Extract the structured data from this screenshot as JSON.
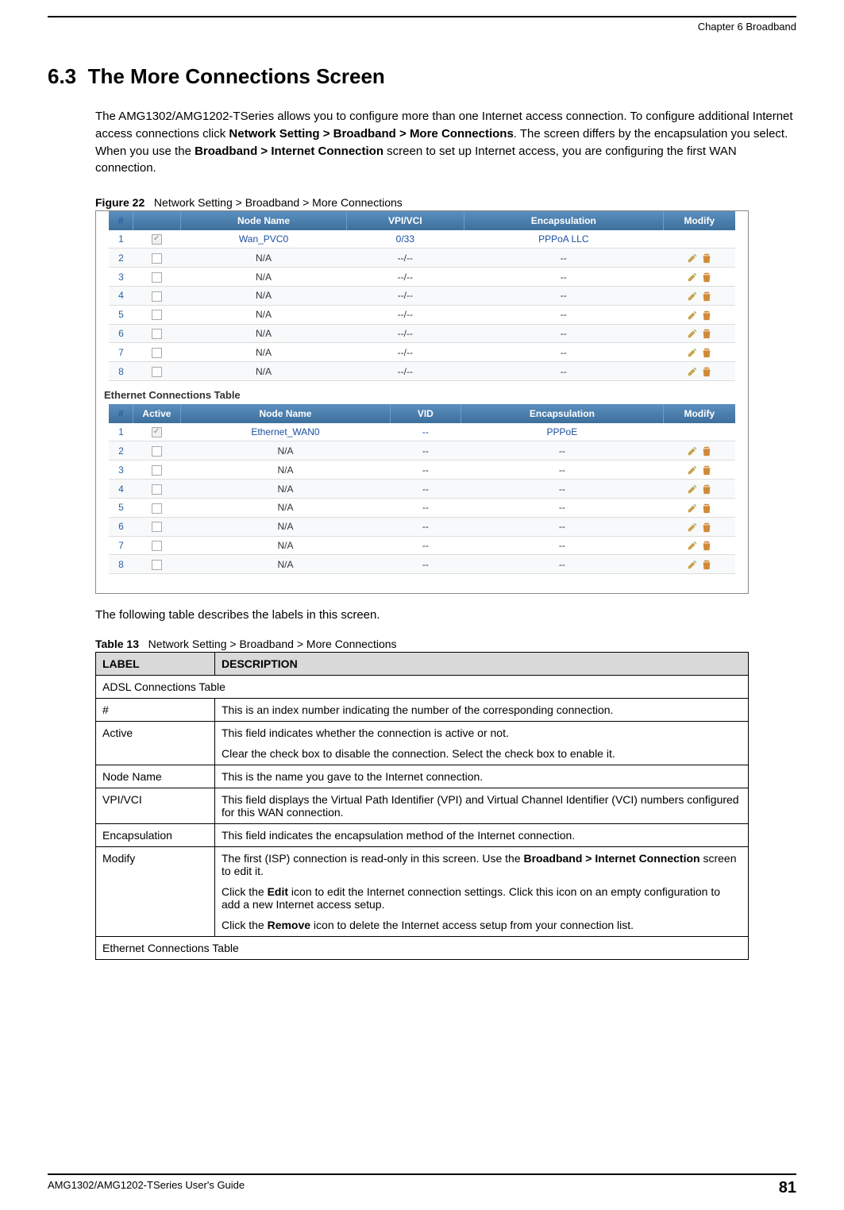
{
  "header": {
    "chapter": "Chapter 6 Broadband"
  },
  "section": {
    "number": "6.3",
    "title": "The More Connections Screen"
  },
  "intro": {
    "text1": "The AMG1302/AMG1202-TSeries allows you to configure more than one Internet access connection. To configure additional Internet access connections click ",
    "bold1": "Network Setting > Broadband > More Connections",
    "text2": ". The screen differs by the encapsulation you select. When you use the ",
    "bold2": "Broadband > Internet Connection",
    "text3": " screen to set up Internet access, you are configuring the first WAN connection."
  },
  "figure": {
    "label": "Figure 22",
    "caption": "Network Setting > Broadband > More Connections"
  },
  "screenshot": {
    "adsl": {
      "headers": [
        "#",
        "",
        "Node Name",
        "VPI/VCI",
        "Encapsulation",
        "Modify"
      ],
      "rows": [
        {
          "n": "1",
          "active": true,
          "disabled": true,
          "node": "Wan_PVC0",
          "vpi": "0/33",
          "enc": "PPPoA LLC",
          "modify": false,
          "first": true
        },
        {
          "n": "2",
          "active": false,
          "node": "N/A",
          "vpi": "--/--",
          "enc": "--",
          "modify": true
        },
        {
          "n": "3",
          "active": false,
          "node": "N/A",
          "vpi": "--/--",
          "enc": "--",
          "modify": true
        },
        {
          "n": "4",
          "active": false,
          "node": "N/A",
          "vpi": "--/--",
          "enc": "--",
          "modify": true
        },
        {
          "n": "5",
          "active": false,
          "node": "N/A",
          "vpi": "--/--",
          "enc": "--",
          "modify": true
        },
        {
          "n": "6",
          "active": false,
          "node": "N/A",
          "vpi": "--/--",
          "enc": "--",
          "modify": true
        },
        {
          "n": "7",
          "active": false,
          "node": "N/A",
          "vpi": "--/--",
          "enc": "--",
          "modify": true
        },
        {
          "n": "8",
          "active": false,
          "node": "N/A",
          "vpi": "--/--",
          "enc": "--",
          "modify": true
        }
      ]
    },
    "eth_title": "Ethernet Connections Table",
    "eth": {
      "headers": [
        "#",
        "Active",
        "Node Name",
        "VID",
        "Encapsulation",
        "Modify"
      ],
      "rows": [
        {
          "n": "1",
          "active": true,
          "disabled": true,
          "node": "Ethernet_WAN0",
          "vid": "--",
          "enc": "PPPoE",
          "modify": false,
          "first": true
        },
        {
          "n": "2",
          "active": false,
          "node": "N/A",
          "vid": "--",
          "enc": "--",
          "modify": true
        },
        {
          "n": "3",
          "active": false,
          "node": "N/A",
          "vid": "--",
          "enc": "--",
          "modify": true
        },
        {
          "n": "4",
          "active": false,
          "node": "N/A",
          "vid": "--",
          "enc": "--",
          "modify": true
        },
        {
          "n": "5",
          "active": false,
          "node": "N/A",
          "vid": "--",
          "enc": "--",
          "modify": true
        },
        {
          "n": "6",
          "active": false,
          "node": "N/A",
          "vid": "--",
          "enc": "--",
          "modify": true
        },
        {
          "n": "7",
          "active": false,
          "node": "N/A",
          "vid": "--",
          "enc": "--",
          "modify": true
        },
        {
          "n": "8",
          "active": false,
          "node": "N/A",
          "vid": "--",
          "enc": "--",
          "modify": true
        }
      ]
    }
  },
  "after": "The following table describes the labels in this screen.",
  "table13": {
    "label": "Table 13",
    "caption": "Network Setting > Broadband > More Connections",
    "head": {
      "label": "LABEL",
      "desc": "DESCRIPTION"
    },
    "rows": [
      {
        "type": "section",
        "text": "ADSL Connections Table"
      },
      {
        "type": "row",
        "label": "#",
        "desc": [
          {
            "t": "This is an index number indicating the number of the corresponding connection."
          }
        ]
      },
      {
        "type": "row",
        "label": "Active",
        "desc": [
          {
            "t": "This field indicates whether the connection is active or not."
          },
          {
            "t": "Clear the check box to disable the connection. Select the check box to enable it."
          }
        ]
      },
      {
        "type": "row",
        "label": "Node Name",
        "desc": [
          {
            "t": "This is the name you gave to the Internet connection."
          }
        ]
      },
      {
        "type": "row",
        "label": "VPI/VCI",
        "desc": [
          {
            "t": "This field displays the Virtual Path Identifier (VPI) and Virtual Channel Identifier (VCI) numbers configured for this WAN connection."
          }
        ]
      },
      {
        "type": "row",
        "label": "Encapsulation",
        "desc": [
          {
            "t": "This field indicates the encapsulation method of the Internet connection."
          }
        ]
      },
      {
        "type": "row",
        "label": "Modify",
        "desc": [
          {
            "pre": "The first (ISP) connection is read-only in this screen. Use the ",
            "bold": "Broadband > Internet Connection",
            "post": " screen to edit it."
          },
          {
            "pre": "Click the ",
            "bold": "Edit",
            "post": " icon to edit the Internet connection settings. Click this icon on an empty configuration to add a new Internet access setup."
          },
          {
            "pre": "Click the ",
            "bold": "Remove",
            "post": " icon to delete the Internet access setup from your connection list."
          }
        ]
      },
      {
        "type": "section",
        "text": "Ethernet Connections Table"
      }
    ]
  },
  "footer": {
    "guide": "AMG1302/AMG1202-TSeries User's Guide",
    "page": "81"
  }
}
